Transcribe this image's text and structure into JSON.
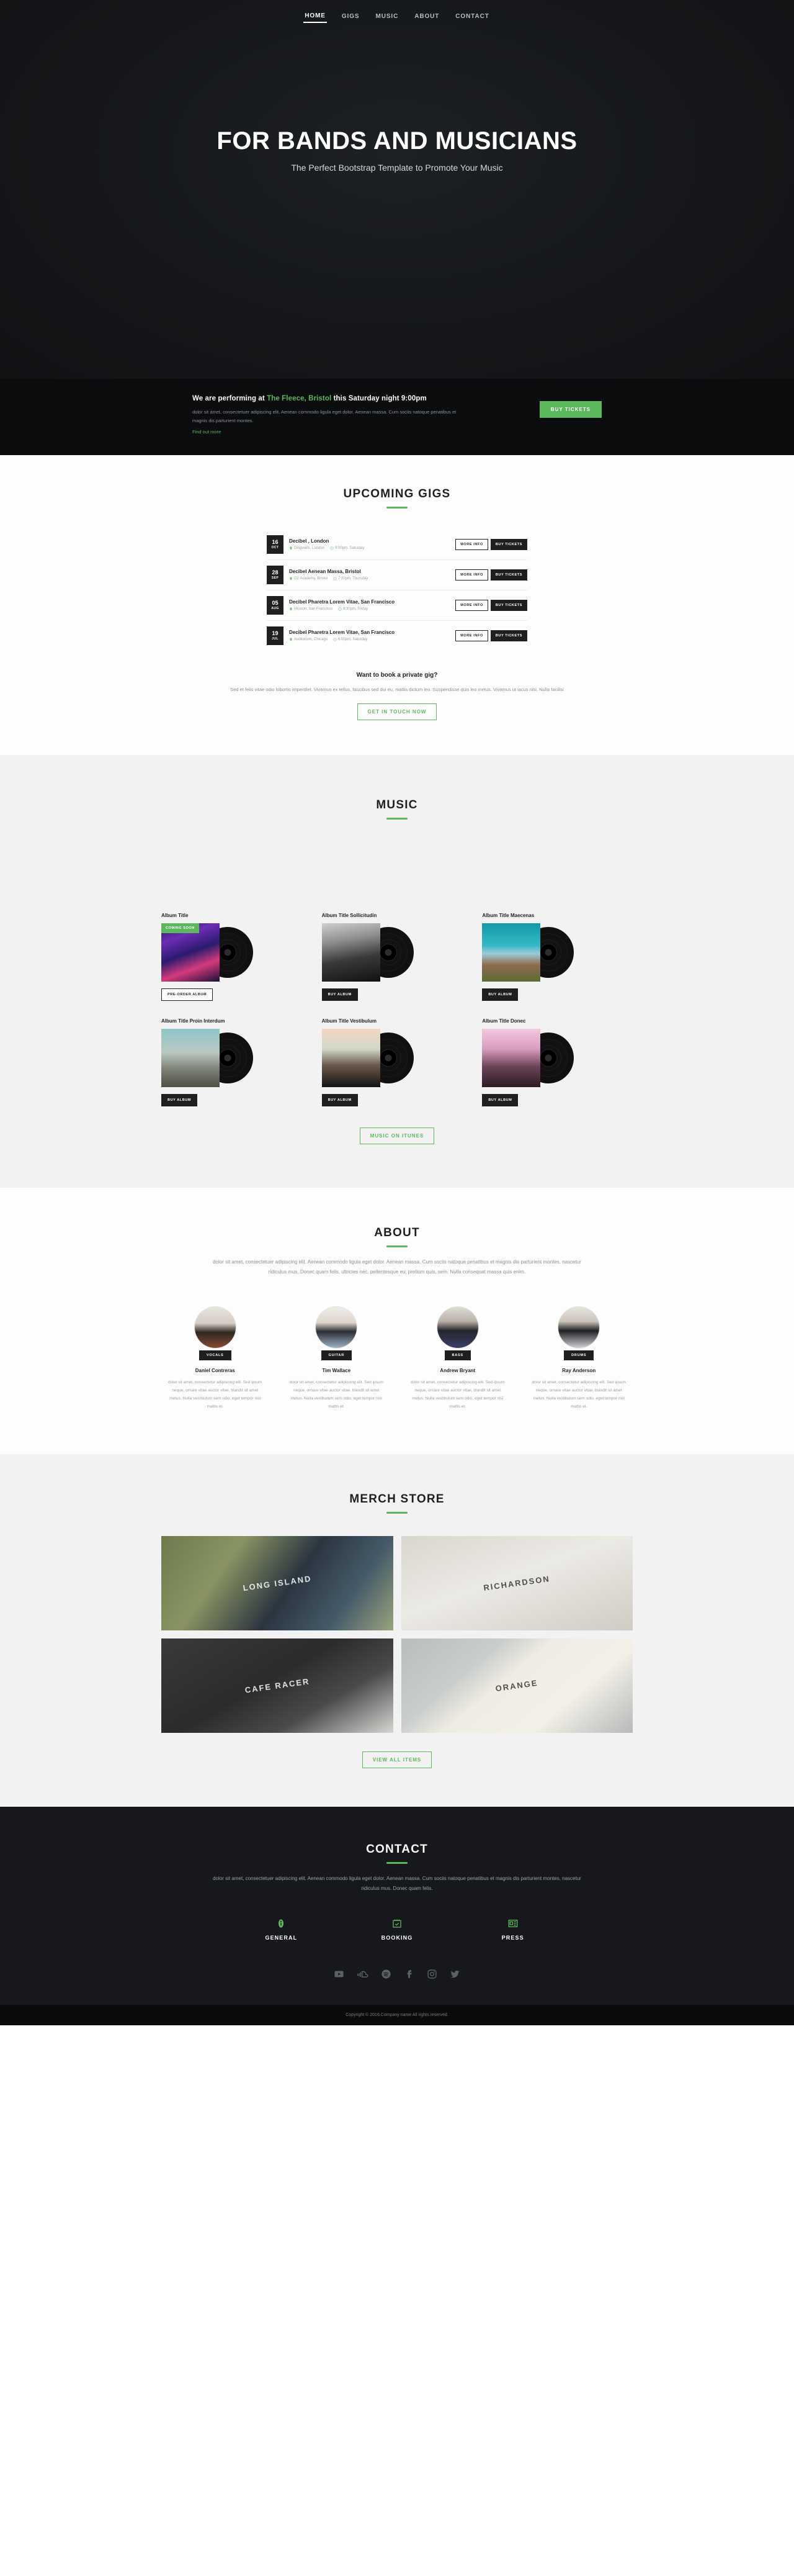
{
  "nav": {
    "items": [
      {
        "label": "HOME",
        "active": true
      },
      {
        "label": "GIGS",
        "active": false
      },
      {
        "label": "MUSIC",
        "active": false
      },
      {
        "label": "ABOUT",
        "active": false
      },
      {
        "label": "CONTACT",
        "active": false
      }
    ]
  },
  "hero": {
    "title": "FOR BANDS AND MUSICIANS",
    "subtitle": "The Perfect Bootstrap Template to Promote Your Music"
  },
  "announce": {
    "head_pre": "We are performing at ",
    "venue": "The Fleece, Bristol",
    "head_post": " this Saturday night 9:00pm",
    "body": "dolor sit amet, consectetuer adipiscing elit. Aenean commodo ligula eget dolor. Aenean massa. Cum sociis natoque penatibus et magnis dis parturient montes.",
    "more_link": "Find out more",
    "cta": "BUY TICKETS"
  },
  "gigs": {
    "title": "UPCOMING GIGS",
    "rows": [
      {
        "day": "16",
        "month": "OCT",
        "name": "Decibel , London",
        "place": "Dingwalls, London",
        "time": "9:00pm, Saturday",
        "info_label": "MORE INFO",
        "ticket_label": "BUY TICKETS"
      },
      {
        "day": "28",
        "month": "SEP",
        "name": "Decibel Aenean Massa, Bristol",
        "place": "O2 Academy, Bristol",
        "time": "7:00pm, Thursday",
        "info_label": "MORE INFO",
        "ticket_label": "BUY TICKETS"
      },
      {
        "day": "05",
        "month": "AUG",
        "name": "Decibel Pharetra Lorem Vitae, San Francisco",
        "place": "Mission, San Francisco",
        "time": "8:30pm, Friday",
        "info_label": "MORE INFO",
        "ticket_label": "BUY TICKETS"
      },
      {
        "day": "19",
        "month": "JUL",
        "name": "Decibel Pharetra Lorem Vitae, San Francisco",
        "place": "Auditorium, Chicago",
        "time": "6:00pm, Saturday",
        "info_label": "MORE INFO",
        "ticket_label": "BUY TICKETS"
      }
    ],
    "private": {
      "title": "Want to book a private gig?",
      "text": "Sed et felis vitae odio lobortis imperdiet. Vivamus ex tellus, faucibus sed dui eu, mattis dictum leo. Suspendisse quis leo metus. Vivamus ut lacus nisi. Nulla facilisi",
      "cta": "GET IN TOUCH NOW"
    }
  },
  "music": {
    "title": "MUSIC",
    "albums": [
      {
        "title": "Album Title",
        "badge": "COMING SOON",
        "button": "PRE-ORDER ALBUM",
        "style": "light",
        "cover": "cov1"
      },
      {
        "title": "Album Title Sollicitudin",
        "badge": "",
        "button": "BUY ALBUM",
        "style": "dark",
        "cover": "cov2"
      },
      {
        "title": "Album Title Maecenas",
        "badge": "",
        "button": "BUY ALBUM",
        "style": "dark",
        "cover": "cov3"
      },
      {
        "title": "Album Title Proin Interdum",
        "badge": "",
        "button": "BUY ALBUM",
        "style": "dark",
        "cover": "cov4"
      },
      {
        "title": "Album Title Vestibulum",
        "badge": "",
        "button": "BUY ALBUM",
        "style": "dark",
        "cover": "cov5"
      },
      {
        "title": "Album Title Donec",
        "badge": "",
        "button": "BUY ALBUM",
        "style": "dark",
        "cover": "cov6"
      }
    ],
    "cta": "MUSIC ON ITUNES"
  },
  "about": {
    "title": "ABOUT",
    "lead": "dolor sit amet, consectetuer adipiscing elit. Aenean commodo ligula eget dolor. Aenean massa. Cum sociis natoque penatibus et magnis dis parturient montes, nascetur ridiculus mus. Donec quam felis, ultricies nec, pellentesque eu, pretium quis, sem. Nulla consequat massa quis enim.",
    "members": [
      {
        "role": "VOCALS",
        "name": "Daniel Contreras",
        "bio": "dolor sit amet, consectetur adipiscing elit. Sed ipsum neque, ornare vitae auctor vitae, blandit sit amet metus. Nulla vestibulum sem odio, eget tempor nisl mattis et.",
        "photo": "ph1"
      },
      {
        "role": "GUITAR",
        "name": "Tim Wallace",
        "bio": "dolor sit amet, consectetur adipiscing elit. Sed ipsum neque, ornare vitae auctor vitae, blandit sit amet metus. Nulla vestibulum sem odio, eget tempor nisl mattis et.",
        "photo": "ph2"
      },
      {
        "role": "BASS",
        "name": "Andrew Bryant",
        "bio": "dolor sit amet, consectetur adipiscing elit. Sed ipsum neque, ornare vitae auctor vitae, blandit sit amet metus. Nulla vestibulum sem odio, eget tempor nisl mattis et.",
        "photo": "ph3"
      },
      {
        "role": "DRUMS",
        "name": "Ray Anderson",
        "bio": "dolor sit amet, consectetur adipiscing elit. Sed ipsum neque, ornare vitae auctor vitae, blandit sit amet metus. Nulla vestibulum sem odio, eget tempor nisl mattis et.",
        "photo": "ph4"
      }
    ]
  },
  "merch": {
    "title": "MERCH STORE",
    "items": [
      {
        "label": "LONG ISLAND",
        "style": "m1",
        "tone": "light"
      },
      {
        "label": "RICHARDSON",
        "style": "m2",
        "tone": "dark"
      },
      {
        "label": "CAFE RACER",
        "style": "m3",
        "tone": "light"
      },
      {
        "label": "ORANGE",
        "style": "m4",
        "tone": "dark"
      }
    ],
    "cta": "VIEW ALL ITEMS"
  },
  "contact": {
    "title": "CONTACT",
    "lead": "dolor sit amet, consectetuer adipiscing elit. Aenean commodo ligula eget dolor. Aenean massa. Cum sociis natoque penatibus et magnis dis parturient montes, nascetur ridiculus mus. Donec quam felis.",
    "columns": [
      {
        "label": "GENERAL",
        "icon": "info-icon"
      },
      {
        "label": "BOOKING",
        "icon": "calendar-check-icon"
      },
      {
        "label": "PRESS",
        "icon": "news-card-icon"
      }
    ],
    "social": [
      {
        "icon": "youtube-icon"
      },
      {
        "icon": "soundcloud-icon"
      },
      {
        "icon": "spotify-icon"
      },
      {
        "icon": "facebook-icon"
      },
      {
        "icon": "instagram-icon"
      },
      {
        "icon": "twitter-icon"
      }
    ],
    "copyright": "Copyright © 2016.Company name All rights reserved."
  },
  "colors": {
    "accent": "#5cb85c",
    "dark": "#1d1f21",
    "hero_bg": "#15171a",
    "grey_bg": "#f2f2f2"
  }
}
